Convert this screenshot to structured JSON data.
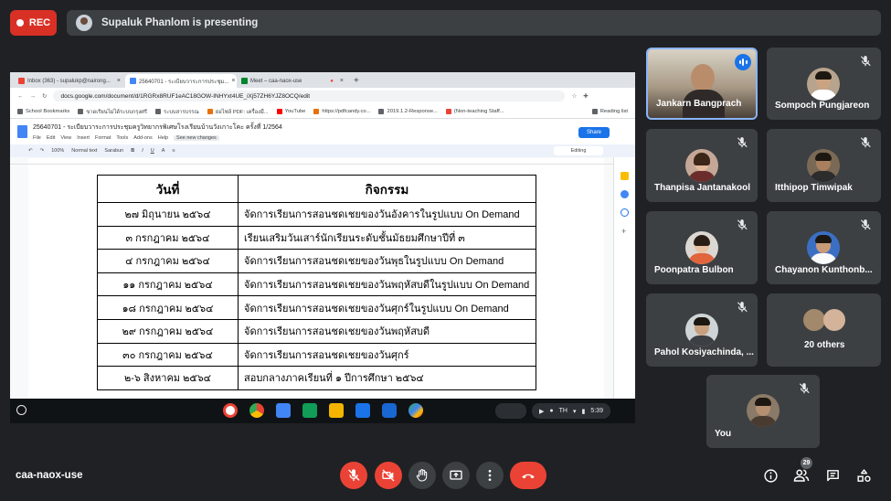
{
  "recording": {
    "label": "REC"
  },
  "presenting": {
    "text": "Supaluk Phanlom is presenting"
  },
  "browser": {
    "tabs": [
      {
        "label": "Inbox (363) - supalukp@nairong...",
        "color": "#ea4335"
      },
      {
        "label": "25640701 - ระเบียบวาระการประชุม...",
        "color": "#4285f4"
      },
      {
        "label": "Meet – caa-naox-use",
        "color": "#00832d"
      }
    ],
    "url": "docs.google.com/document/d/1RGRx8RUF1eAC18GOW-INHYxt4UE_iXj57ZH6YJZ8OCQ/edit",
    "bookmarks": [
      "School Bookmarks",
      "ขาดเรียนไม่ได้ระบบกรุงศรี",
      "ระบบสารบรรณ",
      "ย่อไฟล์ PDF: เครื่องมื...",
      "YouTube",
      "https://pdfcandy.co...",
      "2019.1.2-Response...",
      "(Non-teaching Staff...",
      "Reading list"
    ],
    "reading_list": "Reading list"
  },
  "doc": {
    "title": "25640701 - ระเบียบวาระการประชุมครูวิทยากรพิเศษโรงเรียนบ้านวังเกาะโคะ ครั้งที่ 1/2564",
    "menus": [
      "File",
      "Edit",
      "View",
      "Insert",
      "Format",
      "Tools",
      "Add-ons",
      "Help",
      "See new changes"
    ],
    "share": "Share",
    "zoom": "100%",
    "style": "Normal text",
    "font": "Sarabun",
    "mode": "Editing",
    "table": {
      "headers": [
        "วันที่",
        "กิจกรรม"
      ],
      "rows": [
        [
          "๒๗ มิถุนายน ๒๕๖๔",
          "จัดการเรียนการสอนชดเชยของวันอังคารในรูปแบบ On Demand"
        ],
        [
          "๓ กรกฎาคม ๒๕๖๔",
          "เรียนเสริมวันเสาร์นักเรียนระดับชั้นมัธยมศึกษาปีที่ ๓"
        ],
        [
          "๔ กรกฎาคม ๒๕๖๔",
          "จัดการเรียนการสอนชดเชยของวันพุธในรูปแบบ On Demand"
        ],
        [
          "๑๑ กรกฎาคม ๒๕๖๔",
          "จัดการเรียนการสอนชดเชยของวันพฤหัสบดีในรูปแบบ On Demand"
        ],
        [
          "๑๘ กรกฎาคม ๒๕๖๔",
          "จัดการเรียนการสอนชดเชยของวันศุกร์ในรูปแบบ On Demand"
        ],
        [
          "๒๙ กรกฎาคม ๒๕๖๔",
          "จัดการเรียนการสอนชดเชยของวันพฤหัสบดี"
        ],
        [
          "๓๐ กรกฎาคม ๒๕๖๔",
          "จัดการเรียนการสอนชดเชยของวันศุกร์"
        ],
        [
          "๒-๖ สิงหาคม ๒๕๖๔",
          "สอบกลางภาคเรียนที่ ๑ ปีการศึกษา ๒๕๖๔"
        ]
      ]
    }
  },
  "shelf": {
    "locale": "TH",
    "time": "5:39"
  },
  "participants": [
    {
      "name": "Jankarn Bangprach",
      "speaking": true
    },
    {
      "name": "Sompoch Pungjareon",
      "muted": true
    },
    {
      "name": "Thanpisa Jantanakool",
      "muted": true
    },
    {
      "name": "Itthipop Timwipak",
      "muted": true
    },
    {
      "name": "Poonpatra Bulbon",
      "muted": true
    },
    {
      "name": "Chayanon Kunthonb...",
      "muted": true
    },
    {
      "name": "Pahol Kosiyachinda, ...",
      "muted": true
    },
    {
      "name": "20 others"
    },
    {
      "name": "You",
      "muted": true
    }
  ],
  "meeting": {
    "code": "caa-naox-use",
    "participant_count": "29"
  }
}
